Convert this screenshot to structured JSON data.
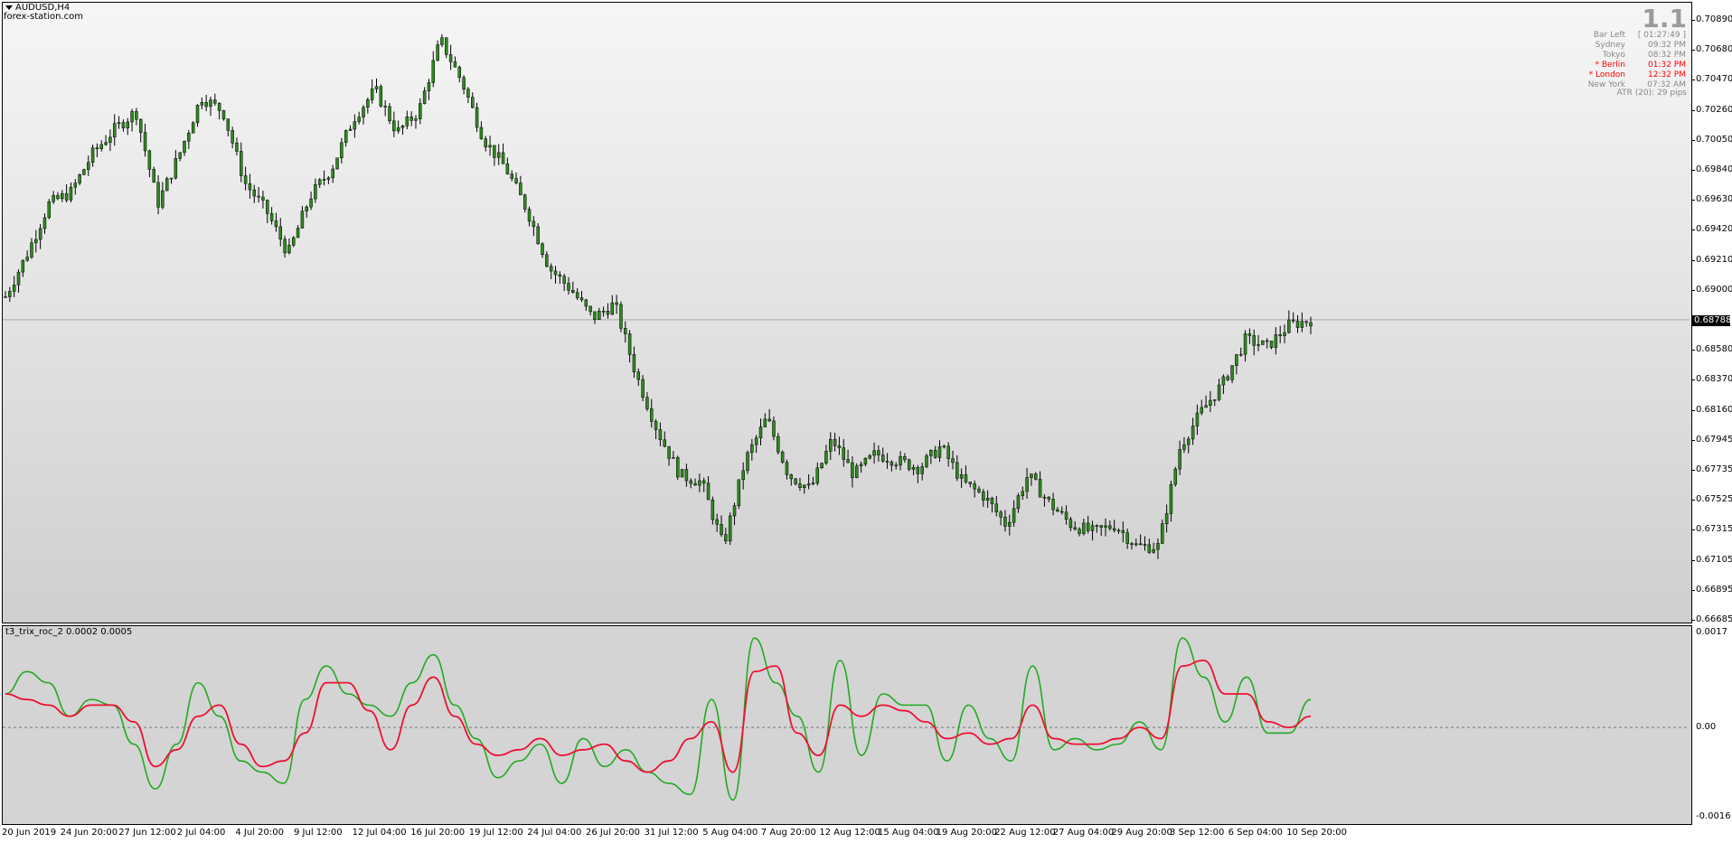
{
  "window": {
    "symbol_title": "AUDUSD,H4",
    "collapse_icon": "triangle-down-icon",
    "watermark": "forex-station.com"
  },
  "info_panel": {
    "spread": "1.1",
    "rows": [
      {
        "label": "Bar Left",
        "value": "[ 01:27:49 ]",
        "color": "#888888"
      },
      {
        "label": "Sydney",
        "value": "09:32 PM",
        "color": "#888888"
      },
      {
        "label": "Tokyo",
        "value": "08:32 PM",
        "color": "#888888"
      },
      {
        "label": "* Berlin",
        "value": "01:32 PM",
        "color": "#ff0000"
      },
      {
        "label": "* London",
        "value": "12:32 PM",
        "color": "#ff0000"
      },
      {
        "label": "New York",
        "value": "07:32 AM",
        "color": "#888888"
      }
    ],
    "atr": "ATR (20): 29 pips"
  },
  "price_axis": {
    "ticks": [
      "0.70890",
      "0.70680",
      "0.70470",
      "0.70260",
      "0.70050",
      "0.69840",
      "0.69630",
      "0.69420",
      "0.69210",
      "0.69000",
      "0.68580",
      "0.68370",
      "0.68160",
      "0.67945",
      "0.67735",
      "0.67525",
      "0.67315",
      "0.67105",
      "0.66895",
      "0.66685"
    ],
    "current_price": "0.68788"
  },
  "indicator": {
    "label": "t3_trix_roc_2 0.0002 0.0005",
    "axis_ticks": [
      "0.0017",
      "0.00",
      "-0.0016"
    ],
    "colors": {
      "fast": "#22aa22",
      "slow": "#ee1133",
      "zero_line": "#777777"
    }
  },
  "time_axis": {
    "labels": [
      "20 Jun 2019",
      "24 Jun 20:00",
      "27 Jun 12:00",
      "2 Jul 04:00",
      "4 Jul 20:00",
      "9 Jul 12:00",
      "12 Jul 04:00",
      "16 Jul 20:00",
      "19 Jul 12:00",
      "24 Jul 04:00",
      "26 Jul 20:00",
      "31 Jul 12:00",
      "5 Aug 04:00",
      "7 Aug 20:00",
      "12 Aug 12:00",
      "15 Aug 04:00",
      "19 Aug 20:00",
      "22 Aug 12:00",
      "27 Aug 04:00",
      "29 Aug 20:00",
      "3 Sep 12:00",
      "6 Sep 04:00",
      "10 Sep 20:00"
    ]
  },
  "chart_data": {
    "type": "candlestick",
    "symbol": "AUDUSD",
    "timeframe": "H4",
    "ylim": [
      0.66685,
      0.7105
    ],
    "candle_colors": {
      "up": "#2e8b1e",
      "down": "#2e8b1e",
      "wick": "#000000"
    },
    "close_path": [
      {
        "t": "20 Jun 2019",
        "price": 0.6895
      },
      {
        "t": "21 Jun",
        "price": 0.6925
      },
      {
        "t": "24 Jun",
        "price": 0.696
      },
      {
        "t": "25 Jun",
        "price": 0.6968
      },
      {
        "t": "26 Jun",
        "price": 0.6995
      },
      {
        "t": "27 Jun",
        "price": 0.7012
      },
      {
        "t": "28 Jun",
        "price": 0.7025
      },
      {
        "t": "1 Jul",
        "price": 0.696
      },
      {
        "t": "2 Jul",
        "price": 0.6995
      },
      {
        "t": "3 Jul",
        "price": 0.7035
      },
      {
        "t": "4 Jul",
        "price": 0.7025
      },
      {
        "t": "5 Jul",
        "price": 0.6975
      },
      {
        "t": "8 Jul",
        "price": 0.6955
      },
      {
        "t": "9 Jul",
        "price": 0.6925
      },
      {
        "t": "10 Jul",
        "price": 0.6965
      },
      {
        "t": "11 Jul",
        "price": 0.6985
      },
      {
        "t": "12 Jul",
        "price": 0.702
      },
      {
        "t": "15 Jul",
        "price": 0.704
      },
      {
        "t": "16 Jul",
        "price": 0.701
      },
      {
        "t": "17 Jul",
        "price": 0.7025
      },
      {
        "t": "18 Jul",
        "price": 0.7075
      },
      {
        "t": "19 Jul",
        "price": 0.7045
      },
      {
        "t": "22 Jul",
        "price": 0.7005
      },
      {
        "t": "23 Jul",
        "price": 0.6985
      },
      {
        "t": "24 Jul",
        "price": 0.6955
      },
      {
        "t": "25 Jul",
        "price": 0.6915
      },
      {
        "t": "26 Jul",
        "price": 0.69
      },
      {
        "t": "29 Jul",
        "price": 0.688
      },
      {
        "t": "30 Jul",
        "price": 0.689
      },
      {
        "t": "31 Jul",
        "price": 0.684
      },
      {
        "t": "1 Aug",
        "price": 0.68
      },
      {
        "t": "2 Aug",
        "price": 0.677
      },
      {
        "t": "5 Aug",
        "price": 0.6765
      },
      {
        "t": "6 Aug",
        "price": 0.672
      },
      {
        "t": "7 Aug",
        "price": 0.678
      },
      {
        "t": "8 Aug",
        "price": 0.681
      },
      {
        "t": "9 Aug",
        "price": 0.677
      },
      {
        "t": "12 Aug",
        "price": 0.676
      },
      {
        "t": "13 Aug",
        "price": 0.6795
      },
      {
        "t": "14 Aug",
        "price": 0.677
      },
      {
        "t": "15 Aug",
        "price": 0.6785
      },
      {
        "t": "16 Aug",
        "price": 0.678
      },
      {
        "t": "19 Aug",
        "price": 0.6775
      },
      {
        "t": "20 Aug",
        "price": 0.679
      },
      {
        "t": "21 Aug",
        "price": 0.6765
      },
      {
        "t": "22 Aug",
        "price": 0.6755
      },
      {
        "t": "23 Aug",
        "price": 0.6735
      },
      {
        "t": "26 Aug",
        "price": 0.677
      },
      {
        "t": "27 Aug",
        "price": 0.675
      },
      {
        "t": "28 Aug",
        "price": 0.6735
      },
      {
        "t": "29 Aug",
        "price": 0.673
      },
      {
        "t": "30 Aug",
        "price": 0.6735
      },
      {
        "t": "2 Sep",
        "price": 0.672
      },
      {
        "t": "3 Sep",
        "price": 0.672
      },
      {
        "t": "4 Sep",
        "price": 0.679
      },
      {
        "t": "5 Sep",
        "price": 0.6815
      },
      {
        "t": "6 Sep",
        "price": 0.6835
      },
      {
        "t": "9 Sep",
        "price": 0.6865
      },
      {
        "t": "10 Sep",
        "price": 0.686
      },
      {
        "t": "11 Sep",
        "price": 0.6875
      },
      {
        "t": "12 Sep",
        "price": 0.68788
      }
    ],
    "indicator_series": [
      {
        "name": "t3_trix_roc_2",
        "role": "fast",
        "color": "#22aa22",
        "ylim": [
          -0.0016,
          0.0017
        ],
        "values": [
          0.0006,
          0.001,
          0.0008,
          0.0002,
          0.0005,
          0.0004,
          -0.0003,
          -0.0011,
          -0.0003,
          0.0008,
          0.0002,
          -0.0006,
          -0.0008,
          -0.001,
          0.0005,
          0.0011,
          0.0006,
          0.0004,
          0.0002,
          0.0008,
          0.0013,
          0.0004,
          -0.0002,
          -0.0009,
          -0.0006,
          -0.0003,
          -0.001,
          -0.0002,
          -0.0007,
          -0.0004,
          -0.0008,
          -0.001,
          -0.0012,
          0.0005,
          -0.0013,
          0.0016,
          0.0008,
          0.0002,
          -0.0008,
          0.0012,
          -0.0005,
          0.0006,
          0.0004,
          0.0004,
          -0.0006,
          0.0004,
          -0.0002,
          -0.0006,
          0.0011,
          -0.0004,
          -0.0002,
          -0.0004,
          -0.0003,
          0.0001,
          -0.0004,
          0.0016,
          0.0009,
          0.0001,
          0.0009,
          -0.0001,
          -0.0001,
          0.0005
        ]
      },
      {
        "name": "t3_trix_roc_2 signal",
        "role": "slow",
        "color": "#ee1133",
        "ylim": [
          -0.0016,
          0.0017
        ],
        "values": [
          0.0006,
          0.0005,
          0.0004,
          0.0002,
          0.0004,
          0.0004,
          0.0001,
          -0.0007,
          -0.0004,
          0.0002,
          0.0004,
          -0.0003,
          -0.0007,
          -0.0006,
          -0.0001,
          0.0008,
          0.0008,
          0.0003,
          -0.0004,
          0.0004,
          0.0009,
          0.0002,
          -0.0003,
          -0.0005,
          -0.0004,
          -0.0002,
          -0.0005,
          -0.0004,
          -0.0003,
          -0.0006,
          -0.0008,
          -0.0006,
          -0.0002,
          0.0001,
          -0.0008,
          0.001,
          0.0011,
          -0.0001,
          -0.0005,
          0.0004,
          0.0002,
          0.0004,
          0.0003,
          0.0001,
          -0.0002,
          -0.0001,
          -0.0003,
          -0.0002,
          0.0004,
          -0.0002,
          -0.0003,
          -0.0003,
          -0.0002,
          0.0,
          -0.0002,
          0.0011,
          0.0012,
          0.0006,
          0.0006,
          0.0001,
          0.0,
          0.0002
        ]
      }
    ]
  }
}
